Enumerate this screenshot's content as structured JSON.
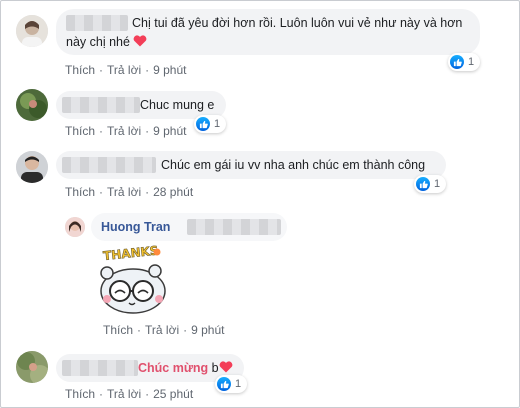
{
  "comments": [
    {
      "text_line1": "Chị tui đã yêu đời hơn rồi. Luôn luôn vui vẻ như này và hơn",
      "text_line2": "này chị nhé",
      "reaction_count": "1",
      "like": "Thích",
      "reply": "Trả lời",
      "time": "9 phút"
    },
    {
      "text": "Chuc mung e",
      "reaction_count": "1",
      "like": "Thích",
      "reply": "Trả lời",
      "time": "9 phút"
    },
    {
      "text": "Chúc em gái iu vv nha anh chúc em thành công",
      "reaction_count": "1",
      "like": "Thích",
      "reply": "Trả lời",
      "time": "28 phút"
    }
  ],
  "reply": {
    "author": "Huong Tran",
    "sticker_text": "THANKS",
    "like": "Thích",
    "reply": "Trả lời",
    "time": "9 phút"
  },
  "last_comment": {
    "text_bold": "Chúc mừng",
    "text_suffix": "b",
    "reaction_count": "1",
    "like": "Thích",
    "reply": "Trả lời",
    "time": "25 phút"
  },
  "separator": "·",
  "colors": {
    "link_blue": "#385898",
    "bubble_bg": "#f2f3f5",
    "heart": "#f33e58",
    "like_blue": "#1877f2",
    "pink_text": "#e0506d"
  },
  "icons": [
    "like-icon",
    "heart-icon"
  ]
}
